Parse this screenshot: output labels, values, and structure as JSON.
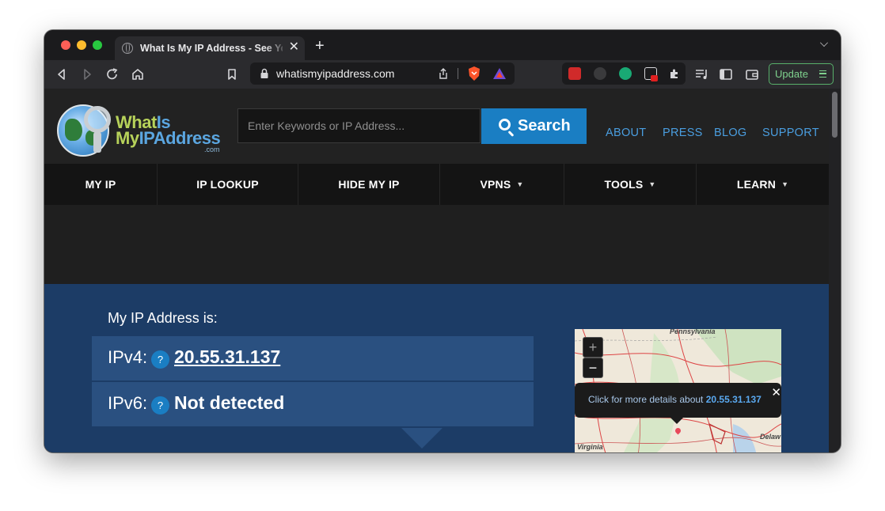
{
  "browser": {
    "tab_title": "What Is My IP Address - See Your",
    "new_tab_glyph": "+",
    "close_glyph": "✕",
    "url": "whatismyipaddress.com",
    "update_label": "Update"
  },
  "site": {
    "logo_line1_a": "What",
    "logo_line1_b": "Is",
    "logo_line2_a": "My",
    "logo_line2_b": "IPAddress",
    "logo_suffix": ".com",
    "search_placeholder": "Enter Keywords or IP Address...",
    "search_label": "Search",
    "top_links": [
      "ABOUT",
      "PRESS",
      "BLOG",
      "SUPPORT"
    ],
    "nav": [
      {
        "label": "MY IP",
        "dropdown": false
      },
      {
        "label": "IP LOOKUP",
        "dropdown": false
      },
      {
        "label": "HIDE MY IP",
        "dropdown": false
      },
      {
        "label": "VPNS",
        "dropdown": true
      },
      {
        "label": "TOOLS",
        "dropdown": true
      },
      {
        "label": "LEARN",
        "dropdown": true
      }
    ],
    "caret": "▼"
  },
  "hero": {
    "heading": "My IP Address is:",
    "ipv4_label": "IPv4:",
    "ipv4_value": "20.55.31.137",
    "ipv6_label": "IPv6:",
    "ipv6_value": "Not detected",
    "help_glyph": "?"
  },
  "map": {
    "zoom_in": "+",
    "zoom_out": "−",
    "popup_text": "Click for more details about ",
    "popup_ip": "20.55.31.137",
    "popup_close": "✕",
    "labels": [
      "Pennsylvania",
      "Virginia",
      "Delaw"
    ]
  },
  "colors": {
    "brand_blue": "#1a7ec3",
    "link_blue": "#4a9ee0",
    "hero_bg": "#1c3c66",
    "update_green": "#7fd28e"
  },
  "icons": [
    "back-icon",
    "forward-icon",
    "reload-icon",
    "home-icon",
    "bookmark-icon",
    "lock-icon",
    "share-icon",
    "brave-shield-icon",
    "brave-rewards-icon",
    "extensions-icon",
    "playlist-icon",
    "sidebar-icon",
    "wallet-icon",
    "search-icon",
    "help-icon"
  ]
}
